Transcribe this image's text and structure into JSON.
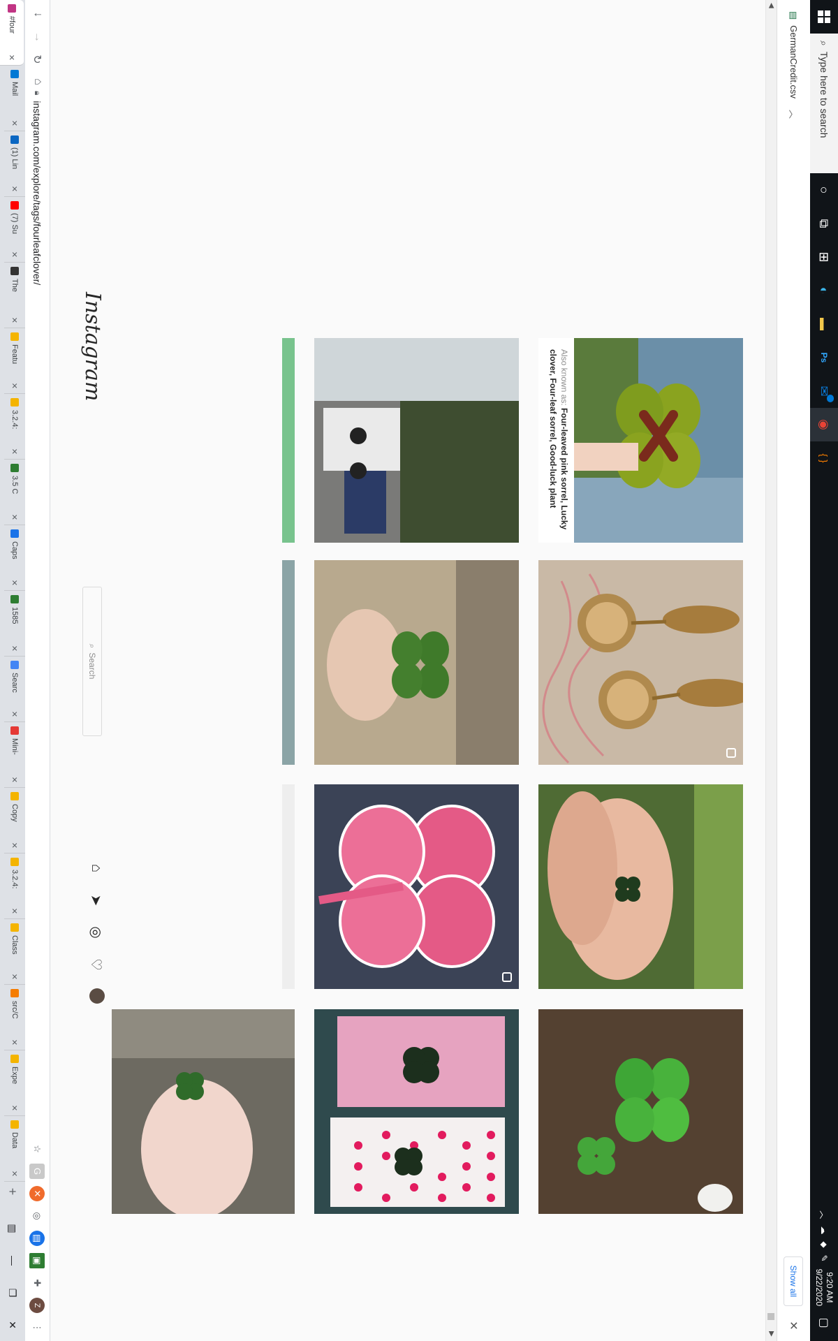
{
  "taskbar": {
    "search_placeholder": "Type here to search",
    "time": "9:20 AM",
    "date": "9/22/2020",
    "mail_badge": "3",
    "apps": [
      {
        "name": "task-view-icon",
        "glyph": "▯▯"
      },
      {
        "name": "windows-store-icon",
        "glyph": "▦"
      },
      {
        "name": "edge-icon",
        "glyph": "◐"
      },
      {
        "name": "file-explorer-icon",
        "glyph": "▬"
      },
      {
        "name": "photoshop-icon",
        "glyph": "Ps"
      },
      {
        "name": "outlook-icon",
        "glyph": "✉"
      },
      {
        "name": "chrome-icon",
        "glyph": "◉"
      },
      {
        "name": "brackets-icon",
        "glyph": "{ }"
      }
    ]
  },
  "downloads": {
    "file_name": "GermanCredit.csv",
    "show_all": "Show all"
  },
  "instagram": {
    "logo": "Instagram",
    "search_placeholder": "Search",
    "topic": {
      "aka_label": "Also known as:",
      "names": "Four-leaved pink sorrel, Lucky clover, Four-leaf sorrel, Good-luck plant"
    }
  },
  "grid": {
    "tiles": [
      {
        "name": "tile-cufflinks",
        "desc": "cufflinks",
        "multi": true
      },
      {
        "name": "tile-hands-clover",
        "desc": "hands clover",
        "multi": false
      },
      {
        "name": "tile-truck",
        "desc": "truck",
        "multi": false
      },
      {
        "name": "tile-clover-fingers",
        "desc": "clover fingers",
        "multi": false
      },
      {
        "name": "tile-pink-clover-painting",
        "desc": "pink clover painting",
        "multi": true
      },
      {
        "name": "tile-clovers-ground",
        "desc": "clovers on ground",
        "multi": false
      },
      {
        "name": "tile-pressed-clovers",
        "desc": "pressed clovers",
        "multi": false
      },
      {
        "name": "tile-hand-holding-clover",
        "desc": "hand holding clover",
        "multi": false
      }
    ]
  },
  "browser": {
    "url": "instagram.com/explore/tags/fourleafclover/",
    "tabs": [
      {
        "title": "#four",
        "color": "#c13584",
        "active": true
      },
      {
        "title": "Mail",
        "color": "#0078d4"
      },
      {
        "title": "(1) Lin",
        "color": "#0a66c2"
      },
      {
        "title": "(7) Su",
        "color": "#ff0000"
      },
      {
        "title": "The ",
        "color": "#333333"
      },
      {
        "title": "Featu",
        "color": "#f4b400"
      },
      {
        "title": "3.2.4:",
        "color": "#f4b400"
      },
      {
        "title": "3.5 C",
        "color": "#2e7d32"
      },
      {
        "title": "Caps",
        "color": "#1a73e8"
      },
      {
        "title": "1585",
        "color": "#2e7d32"
      },
      {
        "title": "Searc",
        "color": "#4285f4"
      },
      {
        "title": "Mini-",
        "color": "#e53935"
      },
      {
        "title": "Copy",
        "color": "#f4b400"
      },
      {
        "title": "3.2.4:",
        "color": "#f4b400"
      },
      {
        "title": "Class",
        "color": "#f4b400"
      },
      {
        "title": "src/C",
        "color": "#f57c00"
      },
      {
        "title": "Expe",
        "color": "#f4b400"
      },
      {
        "title": "Data",
        "color": "#f4b400"
      }
    ],
    "extensions": [
      {
        "name": "bookmark-star-icon",
        "glyph": "☆"
      },
      {
        "name": "grammarly-icon",
        "glyph": "G"
      },
      {
        "name": "ext-orange-icon",
        "glyph": "✖"
      },
      {
        "name": "ext-circle-icon",
        "glyph": "◎"
      },
      {
        "name": "ext-blue-icon",
        "glyph": "⊞"
      },
      {
        "name": "ext-image-icon",
        "glyph": "▣"
      },
      {
        "name": "extensions-puzzle-icon",
        "glyph": "✚"
      },
      {
        "name": "profile-avatar",
        "glyph": "Z"
      },
      {
        "name": "menu-kebab-icon",
        "glyph": "⋮"
      }
    ]
  }
}
